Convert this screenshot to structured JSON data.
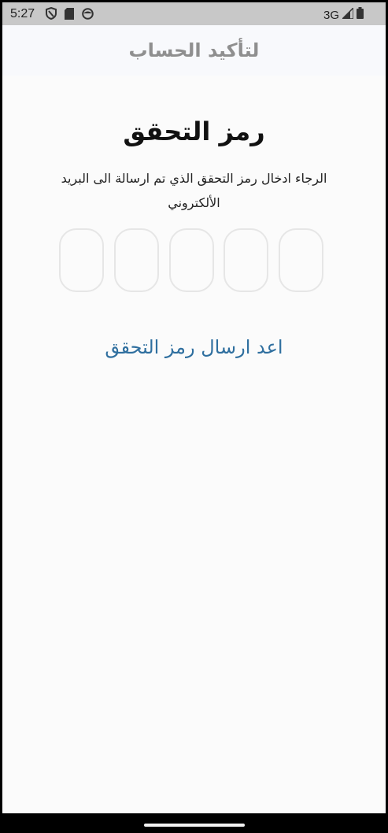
{
  "status_bar": {
    "time": "5:27",
    "network": "3G",
    "icons": [
      "shield-icon",
      "sd-card-icon",
      "face-icon",
      "signal-icon",
      "battery-icon"
    ]
  },
  "app_bar": {
    "title": "لتأكيد الحساب"
  },
  "main": {
    "heading": "رمز التحقق",
    "subtitle": "الرجاء ادخال رمز التحقق الذي تم ارسالة الى البريد الألكتروني",
    "otp": {
      "count": 5,
      "values": [
        "",
        "",
        "",
        "",
        ""
      ]
    },
    "resend_label": "اعد ارسال رمز التحقق"
  },
  "colors": {
    "background": "#fbfbfb",
    "app_bar": "#f8f9fc",
    "status_bar": "#c8c8c8",
    "title": "#8f8f8f",
    "link": "#2f6f9f",
    "otp_border": "#e6e6e6"
  }
}
